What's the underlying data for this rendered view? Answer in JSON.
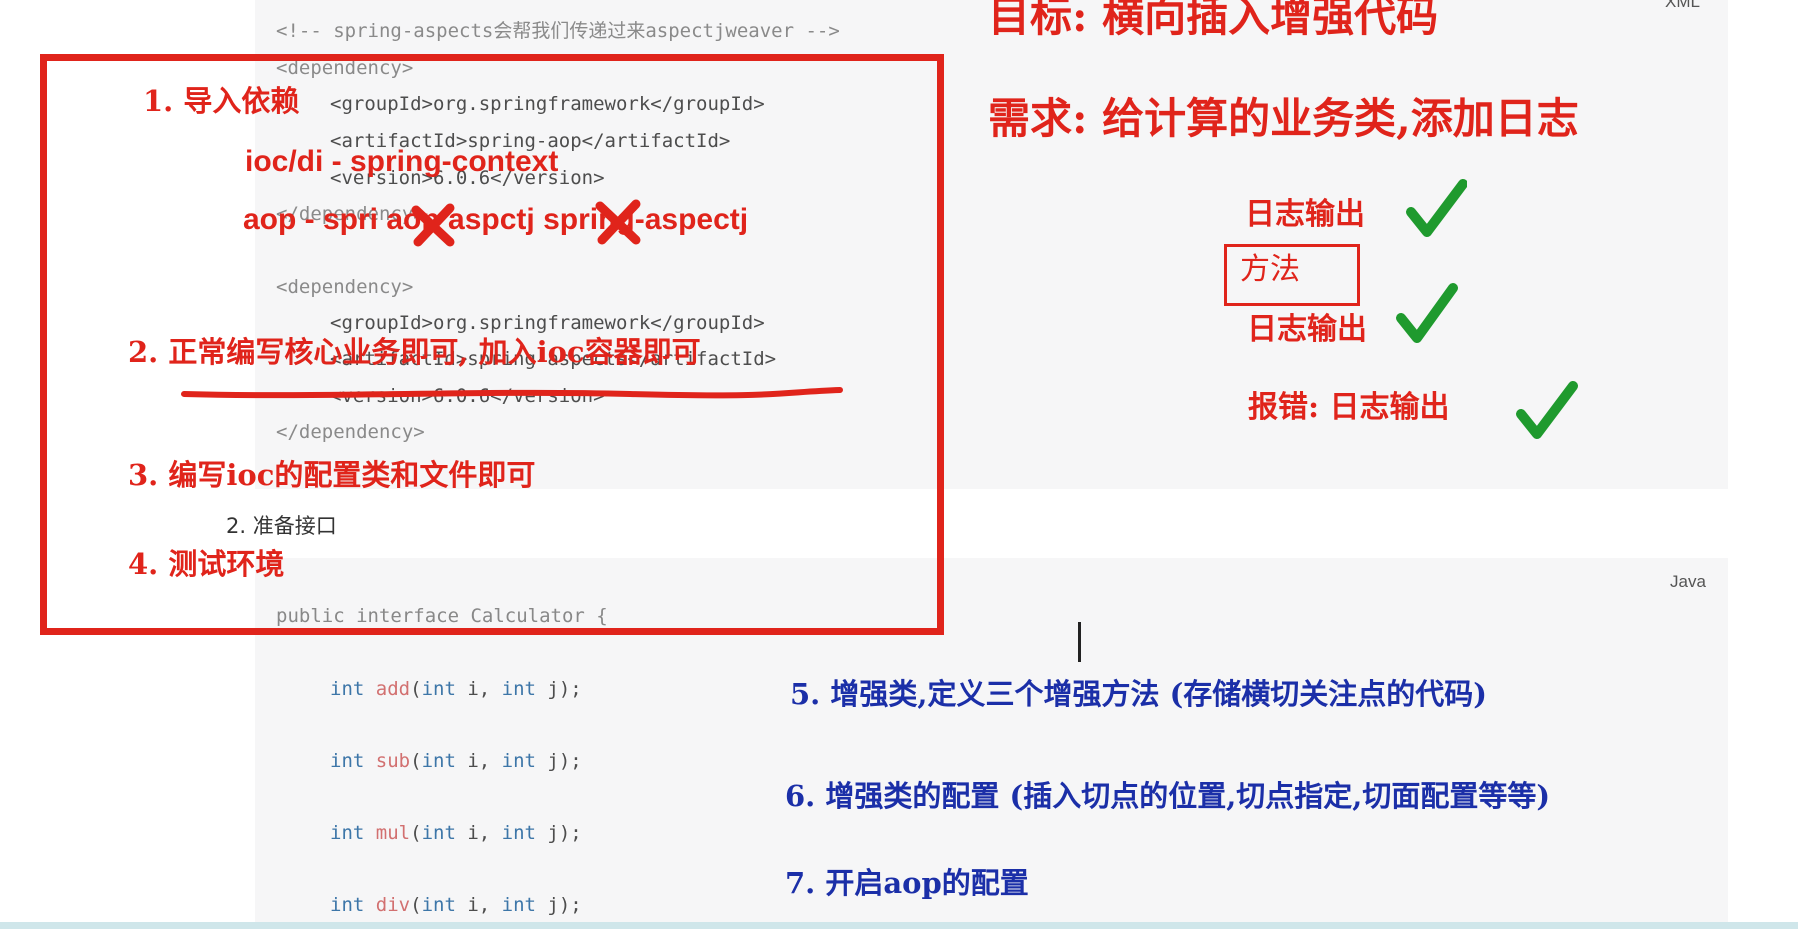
{
  "xml_block": {
    "lang_label": "XML",
    "comment": "<!-- spring-aspects会帮我们传递过来aspectjweaver -->",
    "dep1_open": "<dependency>",
    "dep1_group": "<groupId>org.springframework</groupId>",
    "dep1_artifact": "<artifactId>spring-aop</artifactId>",
    "dep1_version": "<version>6.0.6</version>",
    "dep1_close": "</dependency>",
    "dep2_open": "<dependency>",
    "dep2_group": "<groupId>org.springframework</groupId>",
    "dep2_artifact": "<artifactId>spring-aspects</artifactId>",
    "dep2_version": "<version>6.0.6</version>",
    "dep2_close": "</dependency>"
  },
  "heading_prepare_interface": "2. 准备接口",
  "java_block": {
    "lang_label": "Java",
    "decl": "public interface Calculator {",
    "methods": [
      {
        "ret": "int",
        "name": "add",
        "params_a": "(",
        "t1": "int",
        "p1": " i, ",
        "t2": "int",
        "p2": " j);"
      },
      {
        "ret": "int",
        "name": "sub",
        "params_a": "(",
        "t1": "int",
        "p1": " i, ",
        "t2": "int",
        "p2": " j);"
      },
      {
        "ret": "int",
        "name": "mul",
        "params_a": "(",
        "t1": "int",
        "p1": " i, ",
        "t2": "int",
        "p2": " j);"
      },
      {
        "ret": "int",
        "name": "div",
        "params_a": "(",
        "t1": "int",
        "p1": " i, ",
        "t2": "int",
        "p2": " j);"
      }
    ]
  },
  "annotations": {
    "goal": "目标: 横向插入增强代码",
    "requirement": "需求: 给计算的业务类,添加日志",
    "step1": "1. 导入依赖",
    "ioc_di": "ioc/di   - spring-context",
    "aop_line_a": "aop  - spri",
    "aop_line_b": "  aop  asp",
    "aop_line_c": "ctj  spring-aspectj",
    "step2": "2. 正常编写核心业务即可, 加入ioc容器即可",
    "step3": "3. 编写ioc的配置类和文件即可",
    "step4": "4. 测试环境",
    "log_output_1": "日志输出",
    "method_box": "方法",
    "log_output_2": "日志输出",
    "error_log": "报错: 日志输出",
    "step5": "5. 增强类,定义三个增强方法 (存储横切关注点的代码)",
    "step6": "6. 增强类的配置 (插入切点的位置,切点指定,切面配置等等)",
    "step7": "7. 开启aop的配置"
  },
  "colors": {
    "annotation_red": "#e0241b",
    "annotation_blue": "#1b2fa8",
    "check_green": "#1f9a2e",
    "code_bg": "#f6f6f7"
  }
}
